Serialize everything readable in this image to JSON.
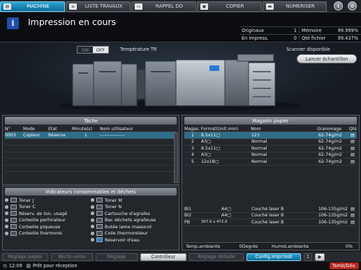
{
  "tabs": [
    {
      "label": "MACHINE",
      "icon": "printer-icon",
      "active": true
    },
    {
      "label": "LISTE TRAVAUX",
      "icon": "list-icon",
      "active": false
    },
    {
      "label": "RAPPEL DD",
      "icon": "hdd-icon",
      "active": false
    },
    {
      "label": "COPIER",
      "icon": "copier-icon",
      "active": false
    },
    {
      "label": "NUMERISER",
      "icon": "scanner-icon",
      "active": false
    }
  ],
  "header": {
    "title": "Impression en cours",
    "stats": [
      {
        "l1": "Originaux",
        "v1": "1",
        "l2": "Mémoire",
        "v2": "99.999%"
      },
      {
        "l1": "En impress.",
        "v1": "0",
        "l2": "Qté fichier",
        "v2": "99.437%"
      }
    ]
  },
  "machine": {
    "toggle_on": "ON",
    "toggle_off": "OFF",
    "temp_label": "Température TR",
    "scanner_status": "Scanner disponible",
    "sample_button": "Lancer échantillon"
  },
  "task": {
    "title": "Tâche",
    "columns": [
      "N°",
      "Mode",
      "Etat",
      "Minute(s)",
      "Nom utilisateur"
    ],
    "rows": [
      {
        "no": "0003",
        "mode": "Copieur",
        "state": "Réserve",
        "min": "1",
        "user": "----------------"
      }
    ]
  },
  "tray": {
    "title": "Magasin papier",
    "columns": [
      "Magas.",
      "Format(Unit.mm)",
      "Nom",
      "Grammage",
      "Qté"
    ],
    "rows": [
      {
        "mag": "1",
        "format": "8.5x11▢",
        "name": "123",
        "gram": "62-74g/m2",
        "sel": true
      },
      {
        "mag": "2",
        "format": "A3▢",
        "name": "Normal",
        "gram": "62-74g/m2"
      },
      {
        "mag": "3",
        "format": "8.5x11▢",
        "name": "Normal",
        "gram": "62-74g/m2"
      },
      {
        "mag": "4",
        "format": "A3▢",
        "name": "Normal",
        "gram": "62-74g/m2"
      },
      {
        "mag": "5",
        "format": "12x18▢",
        "name": "Normal",
        "gram": "62-74g/m2"
      }
    ],
    "extra": [
      {
        "mag": "BI1",
        "format": "A4▢",
        "name": "Couché laser B",
        "gram": "106-135g/m2"
      },
      {
        "mag": "BI2",
        "format": "A4▢",
        "name": "Couché laser B",
        "gram": "106-135g/m2"
      },
      {
        "mag": "PB",
        "format": "307.0 x 472.0",
        "name": "Couché laser B",
        "gram": "106-135g/m2"
      }
    ],
    "temp_label": "Temp.ambiante",
    "temp_value": "0Degrés",
    "hum_label": "Humid.ambiante",
    "hum_value": "0%"
  },
  "consumables": {
    "title": "Indicateurs consommables et déchets",
    "items": [
      {
        "label": "Toner J",
        "icon": "toner-icon"
      },
      {
        "label": "Toner M",
        "icon": "toner-icon"
      },
      {
        "label": "Toner C",
        "icon": "toner-icon"
      },
      {
        "label": "Toner N",
        "icon": "toner-icon"
      },
      {
        "label": "Réserv. de ton. usagé",
        "icon": "waste-toner-icon"
      },
      {
        "label": "Cartouche d'agrafes",
        "icon": "staple-icon"
      },
      {
        "label": "Corbeille perforateur",
        "icon": "punch-icon"
      },
      {
        "label": "Bac déchets agrafeuse",
        "icon": "staple-waste-icon"
      },
      {
        "label": "Corbeille piqueuse",
        "icon": "bin-icon"
      },
      {
        "label": "Butée lame massicot",
        "icon": "trimmer-icon"
      },
      {
        "label": "Corbeille thermorel.",
        "icon": "bin-icon"
      },
      {
        "label": "Colle thermorelieur",
        "icon": "glue-icon"
      },
      {
        "label": "",
        "icon": ""
      },
      {
        "label": "Réservoir d'eau",
        "icon": "water-icon"
      }
    ]
  },
  "bottom": {
    "b1": "Réglage papier",
    "b2": "Recto-verso",
    "b3": "Réglage",
    "b4": "Contrôleur",
    "b5": "Réglage détaillé",
    "b6": "Config.impr.test",
    "page": "1",
    "arrow": "▶"
  },
  "status": {
    "time": "12:09",
    "message": "Prêt pour réception",
    "jam": "Tamb/Dév."
  }
}
